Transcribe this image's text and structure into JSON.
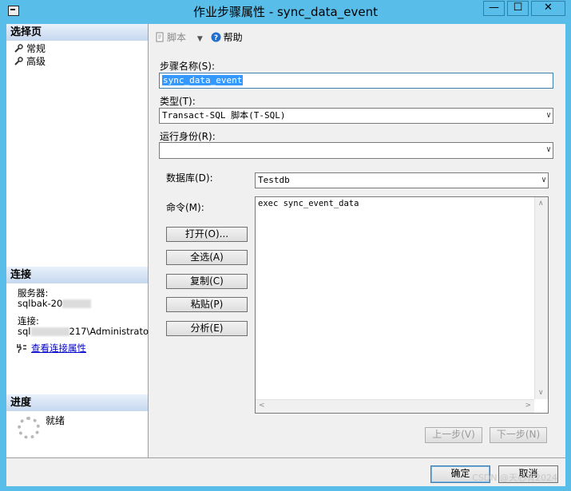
{
  "window": {
    "title": "作业步骤属性 - sync_data_event",
    "minimize": "—",
    "maximize": "☐",
    "close": "✕"
  },
  "left_panel": {
    "select_page_header": "选择页",
    "pages": [
      {
        "label": "常规"
      },
      {
        "label": "高级"
      }
    ],
    "connection_header": "连接",
    "server_label": "服务器:",
    "server_value": "sqlbak-20",
    "connection_label": "连接:",
    "connection_value_prefix": "sql",
    "connection_value_suffix": "217\\Administrato",
    "view_connection_link": "查看连接属性",
    "progress_header": "进度",
    "progress_status": "就绪"
  },
  "toolbar": {
    "script_label": "脚本",
    "help_label": "帮助"
  },
  "form": {
    "step_name_label": "步骤名称(S):",
    "step_name_value": "sync_data_event",
    "type_label": "类型(T):",
    "type_value": "Transact-SQL 脚本(T-SQL)",
    "run_as_label": "运行身份(R):",
    "run_as_value": "",
    "database_label": "数据库(D):",
    "database_value": "Testdb",
    "command_label": "命令(M):",
    "command_value": "exec sync_event_data",
    "open_button": "打开(O)...",
    "select_all_button": "全选(A)",
    "copy_button": "复制(C)",
    "paste_button": "粘贴(P)",
    "parse_button": "分析(E)",
    "prev_button": "上一步(V)",
    "next_button": "下一步(N)"
  },
  "footer": {
    "ok_button": "确定",
    "cancel_button": "取消",
    "watermark": "CSDN @天心有2024"
  },
  "colors": {
    "titlebar": "#58bde9",
    "selection": "#3399ff",
    "link": "#0000cc"
  }
}
